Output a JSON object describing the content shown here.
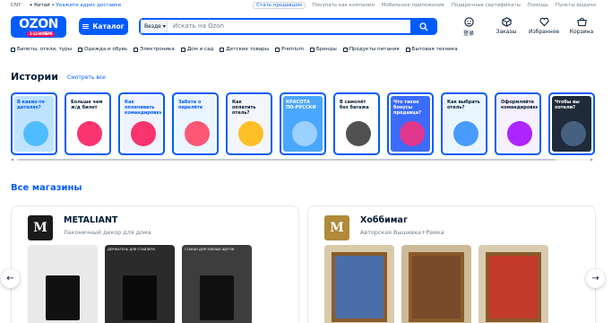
{
  "topbar": {
    "currency": "CNY",
    "city": "Китай",
    "separator": "•",
    "address_link": "Укажите адрес доставки",
    "links": [
      "Стать продавцом",
      "Покупать как компания",
      "Мобильное приложение",
      "Подарочные сертификаты",
      "Помощь",
      "Пункты выдачи"
    ]
  },
  "header": {
    "logo_text": "OZON",
    "logo_sub": "1–12 НОЯБРЯ",
    "catalog_label": "Каталог",
    "search_scope": "Везде",
    "search_placeholder": "Искать на Ozon",
    "icons": [
      {
        "icon": "user-icon",
        "label": "登录"
      },
      {
        "icon": "box-icon",
        "label": "Заказы"
      },
      {
        "icon": "heart-icon",
        "label": "Избранное"
      },
      {
        "icon": "cart-icon",
        "label": "Корзина"
      }
    ]
  },
  "categories": [
    "Билеты, отели, туры",
    "Одежда и обувь",
    "Электроника",
    "Дом и сад",
    "Детские товары",
    "Premium",
    "Бренды",
    "Продукты питания",
    "Бытовая техника"
  ],
  "stories": {
    "title": "Истории",
    "see_all": "Смотреть все",
    "items": [
      {
        "text": "В каких-то деталях?",
        "bg": "#bfe3ff",
        "fg": "#005bff",
        "art": "#3bb5ff"
      },
      {
        "text": "Больше чем ж/д билет",
        "bg": "#ffffff",
        "fg": "#001a34",
        "art": "#f91155"
      },
      {
        "text": "Как оплачивать командировки",
        "bg": "#eef3ff",
        "fg": "#005bff",
        "art": "#f91155"
      },
      {
        "text": "Забота о перелёте",
        "bg": "#e9f6ff",
        "fg": "#005bff",
        "art": "#ff3b5c"
      },
      {
        "text": "Как оплатить отель?",
        "bg": "#f4f6fb",
        "fg": "#001a34",
        "art": "#ffb400"
      },
      {
        "text": "КРАСОТА ПО-РУССКИ",
        "bg": "#4aa7ff",
        "fg": "#ffffff",
        "art": "#a8d8ff"
      },
      {
        "text": "В самолёт без багажа",
        "bg": "#ffffff",
        "fg": "#001a34",
        "art": "#333333"
      },
      {
        "text": "Что такое бонусы продавца?",
        "bg": "#3b6cff",
        "fg": "#ffffff",
        "art": "#ff2d7a"
      },
      {
        "text": "Как выбрать отель?",
        "bg": "#eaf6ff",
        "fg": "#001a34",
        "art": "#2c8cff"
      },
      {
        "text": "Оформляйте командировки",
        "bg": "#f6f0ff",
        "fg": "#001a34",
        "art": "#a100ff"
      },
      {
        "text": "Чтобы вы хотели?",
        "bg": "#1f2b3a",
        "fg": "#ffffff",
        "art": "#4c6b8c"
      }
    ]
  },
  "shops": {
    "title": "Все магазины",
    "items": [
      {
        "name": "METALIANT",
        "desc": "Лаконичный декор для дома",
        "logo_text": "M",
        "logo_bg": "#1b1b1b",
        "products": [
          {
            "caption": "",
            "bg": "#e9e9e9",
            "obj": "#111111"
          },
          {
            "caption": "Держатель для стайлера",
            "bg": "#2b2b2b",
            "obj": "#0a0a0a"
          },
          {
            "caption": "Стакан для зубных щеток",
            "bg": "#3d3d3d",
            "obj": "#111111"
          }
        ]
      },
      {
        "name": "Хоббимаг",
        "desc": "Авторская Вышивка+Рамка",
        "logo_text": "M",
        "logo_bg": "#b08a3a",
        "products": [
          {
            "caption": "",
            "bg": "#d8c9a8",
            "obj": "#4a6fa8"
          },
          {
            "caption": "",
            "bg": "#cdbb98",
            "obj": "#7a4b2a"
          },
          {
            "caption": "",
            "bg": "#d9cbb0",
            "obj": "#c43a2a"
          }
        ]
      }
    ]
  },
  "nav": {
    "prev": "←",
    "next": "→"
  }
}
